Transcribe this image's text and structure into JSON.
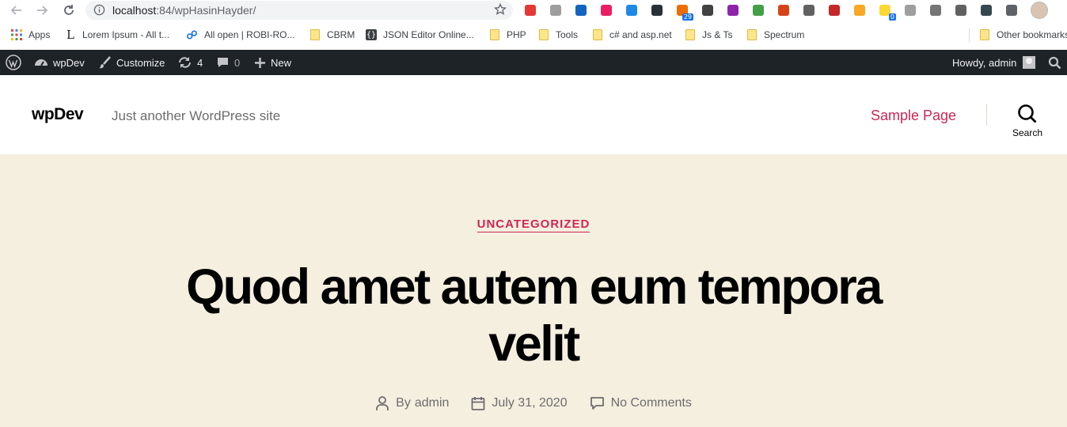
{
  "browser": {
    "url_host": "localhost",
    "url_path": ":84/wpHasinHayder/",
    "extensions": [
      {
        "icon": "opera-ext-icon",
        "color": "#e53935"
      },
      {
        "icon": "mail-x-ext-icon",
        "color": "#9e9e9e"
      },
      {
        "icon": "v-ext-icon",
        "color": "#1565c0"
      },
      {
        "icon": "t-ext-icon",
        "color": "#e91e63"
      },
      {
        "icon": "window-ext-icon",
        "color": "#1e88e5"
      },
      {
        "icon": "circle-arrow-ext-icon",
        "color": "#263238"
      },
      {
        "icon": "badge-29-ext-icon",
        "color": "#ef6c00",
        "badge": "29"
      },
      {
        "icon": "new-ext-icon",
        "color": "#424242"
      },
      {
        "icon": "purple-ext-icon",
        "color": "#8e24aa"
      },
      {
        "icon": "globe-green-ext-icon",
        "color": "#43a047"
      },
      {
        "icon": "bug-ext-icon",
        "color": "#d84315"
      },
      {
        "icon": "gear-ext-icon",
        "color": "#616161"
      },
      {
        "icon": "red-ext-icon",
        "color": "#c62828"
      },
      {
        "icon": "pencil-ext-icon",
        "color": "#f9a825"
      },
      {
        "icon": "note-ext-icon",
        "color": "#fdd835",
        "badge": "0"
      },
      {
        "icon": "world-ext-icon",
        "color": "#9e9e9e"
      },
      {
        "icon": "camera-ext-icon",
        "color": "#757575"
      },
      {
        "icon": "eyedropper-ext-icon",
        "color": "#616161"
      },
      {
        "icon": "dark-circle-ext-icon",
        "color": "#37474f"
      },
      {
        "icon": "puzzle-ext-icon",
        "color": "#5f6368"
      }
    ]
  },
  "bookmarks": {
    "apps": "Apps",
    "items": [
      "Lorem Ipsum - All t...",
      "All open | ROBI-RO...",
      "CBRM",
      "JSON Editor Online...",
      "PHP",
      "Tools",
      "c# and asp.net",
      "Js & Ts",
      "Spectrum"
    ],
    "other": "Other bookmarks"
  },
  "adminbar": {
    "site": "wpDev",
    "customize": "Customize",
    "updates": "4",
    "comments": "0",
    "new": "New",
    "howdy": "Howdy, admin"
  },
  "header": {
    "site_title": "wpDev",
    "description": "Just another WordPress site",
    "menu_item": "Sample Page",
    "search_label": "Search"
  },
  "entry": {
    "category": "UNCATEGORIZED",
    "title": "Quod amet autem eum tempora velit",
    "by_prefix": "By",
    "author": "admin",
    "date": "July 31, 2020",
    "comments": "No Comments"
  },
  "colors": {
    "accent": "#cd2653",
    "admin_bar": "#1d2327",
    "hero_bg": "#f5efe0"
  }
}
